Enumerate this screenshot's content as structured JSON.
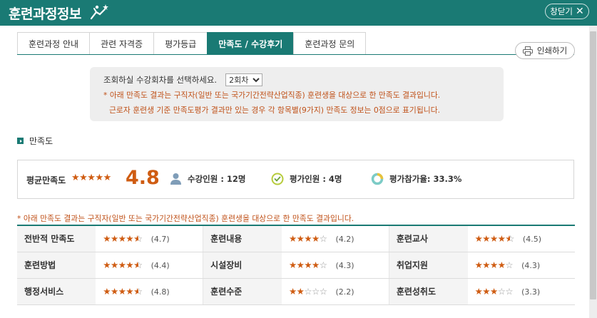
{
  "header": {
    "title": "훈련과정정보",
    "close_label": "창닫기"
  },
  "tabs": [
    "훈련과정 안내",
    "관련 자격증",
    "평가등급",
    "만족도 / 수강후기",
    "훈련과정 문의"
  ],
  "active_tab": "만족도 / 수강후기",
  "print_label": "인쇄하기",
  "notice": {
    "select_label": "조회하실 수강회차를 선택하세요.",
    "selected_round": "2회차",
    "line1": "* 아래 만족도 결과는 구직자(일반 또는 국가기간전략산업직종) 훈련생을 대상으로 한 만족도 결과입니다.",
    "line2": "근로자 훈련생 기준 만족도평가 결과만 있는 경우 각 항목별(9가지) 만족도 정보는 0점으로 표기됩니다."
  },
  "section_title": "만족도",
  "summary": {
    "avg_label": "평균만족도",
    "avg_score": "4.8",
    "enrolled": "수강인원 : 12명",
    "evaluated": "평가인원 : 4명",
    "participation": "평가참가율: 33.3%"
  },
  "note": "* 아래 만족도 결과는 구직자(일반 또는 국가기간전략산업직종) 훈련생을 대상으로 한 만족도 결과입니다.",
  "ratings": [
    [
      {
        "label": "전반적 만족도",
        "score": "(4.7)",
        "value": 4.7
      },
      {
        "label": "훈련내용",
        "score": "(4.2)",
        "value": 4.2
      },
      {
        "label": "훈련교사",
        "score": "(4.5)",
        "value": 4.5
      }
    ],
    [
      {
        "label": "훈련방법",
        "score": "(4.4)",
        "value": 4.4
      },
      {
        "label": "시설장비",
        "score": "(4.3)",
        "value": 4.3
      },
      {
        "label": "취업지원",
        "score": "(4.3)",
        "value": 4.3
      }
    ],
    [
      {
        "label": "행정서비스",
        "score": "(4.8)",
        "value": 4.8
      },
      {
        "label": "훈련수준",
        "score": "(2.2)",
        "value": 2.2
      },
      {
        "label": "훈련성취도",
        "score": "(3.3)",
        "value": 3.3
      }
    ]
  ],
  "colors": {
    "primary": "#1a7a74",
    "accent": "#cf5c12",
    "notice_text": "#c0521a"
  }
}
